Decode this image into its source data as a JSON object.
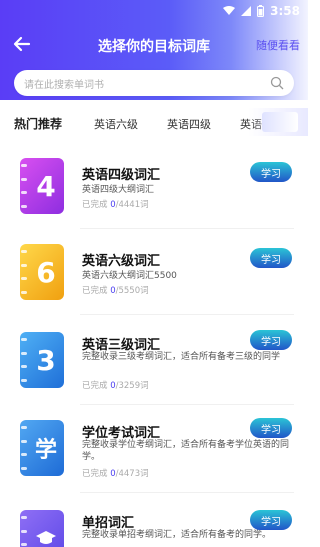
{
  "status": {
    "time": "3:58"
  },
  "nav": {
    "title": "选择你的目标词库",
    "right": "随便看看"
  },
  "search": {
    "placeholder": "请在此搜索单词书"
  },
  "tabs": {
    "hot": "热门推荐",
    "items": [
      "英语六级",
      "英语四级",
      "英语三"
    ]
  },
  "books": [
    {
      "glyph": "4",
      "title": "英语四级词汇",
      "desc": "英语四级大纲词汇",
      "done": "0",
      "total": "/4441词",
      "button": "学习",
      "color": "#b03ae8"
    },
    {
      "glyph": "6",
      "title": "英语六级词汇",
      "desc": "英语六级大纲词汇5500",
      "done": "0",
      "total": "/5550词",
      "button": "学习",
      "color": "#f2b51a"
    },
    {
      "glyph": "3",
      "title": "英语三级词汇",
      "desc": "完整收录三级考纲词汇，适合所有备考三级的同学",
      "done": "0",
      "total": "/3259词",
      "button": "学习",
      "color": "#2c8de4"
    },
    {
      "glyph": "学",
      "title": "学位考试词汇",
      "desc": "完整收录学位考纲词汇，适合所有备考学位英语的同学。",
      "done": "0",
      "total": "/4473词",
      "button": "学习",
      "color": "#2a86e0"
    },
    {
      "glyph": "",
      "title": "单招词汇",
      "desc": "完整收录单招考纲词汇，适合所有备考的同学。",
      "done": "",
      "total": "",
      "button": "学习",
      "color": "#6b5ae8"
    }
  ],
  "progress_prefix": "已完成 "
}
